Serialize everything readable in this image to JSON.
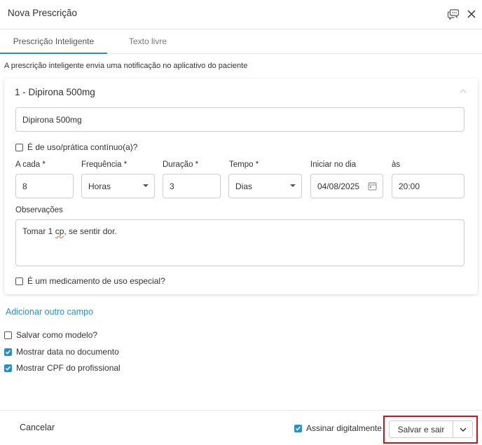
{
  "modal": {
    "title": "Nova Prescrição"
  },
  "tabs": [
    {
      "label": "Prescrição Inteligente",
      "active": true
    },
    {
      "label": "Texto livre",
      "active": false
    }
  ],
  "info_text": "A prescrição inteligente envia uma notificação no aplicativo do paciente",
  "prescription": {
    "title": "1 - Dipirona 500mg",
    "medication": "Dipirona 500mg",
    "continuous_label": "É de uso/prática contínuo(a)?",
    "continuous_checked": false,
    "fields": {
      "a_cada": {
        "label": "A cada *",
        "value": "8"
      },
      "frequencia": {
        "label": "Frequência *",
        "value": "Horas"
      },
      "duracao": {
        "label": "Duração *",
        "value": "3"
      },
      "tempo": {
        "label": "Tempo *",
        "value": "Dias"
      },
      "iniciar": {
        "label": "Iniciar no dia",
        "value": "04/08/2025"
      },
      "as": {
        "label": "às",
        "value": "20:00"
      }
    },
    "observacoes_label": "Observações",
    "observacoes": {
      "part1": "Tomar 1 ",
      "misspelled": "cp",
      "part2": ", se sentir dor."
    },
    "special_label": "É um medicamento de uso especial?",
    "special_checked": false
  },
  "add_field_link": "Adicionar outro campo",
  "options": [
    {
      "label": "Salvar como modelo?",
      "checked": false
    },
    {
      "label": "Mostrar data no documento",
      "checked": true
    },
    {
      "label": "Mostrar CPF do profissional",
      "checked": true
    }
  ],
  "footer": {
    "cancel": "Cancelar",
    "sign_label": "Assinar digitalmente",
    "sign_checked": true,
    "save_label": "Salvar e sair"
  },
  "colors": {
    "accent": "#2b8fc4",
    "highlight": "#d01414"
  }
}
